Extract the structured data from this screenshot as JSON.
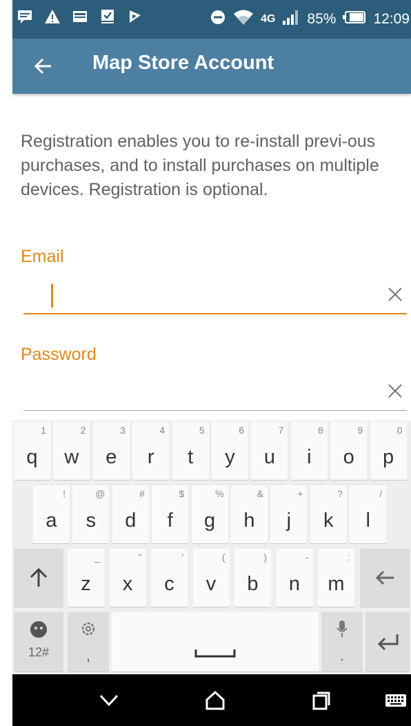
{
  "status_bar": {
    "battery": "85%",
    "time": "12:09",
    "network": "4G",
    "icons": [
      "message-icon",
      "warning-icon",
      "image-icon",
      "checkbox-icon",
      "flag-icon",
      "do-not-disturb-icon",
      "wifi-icon",
      "signal-icon",
      "battery-icon"
    ]
  },
  "appbar": {
    "title": "Map Store Account",
    "back_icon": "arrow-back-icon"
  },
  "content": {
    "description": "Registration enables you to re-install previ-ous purchases, and to install purchases on multiple devices. Registration is optional.",
    "email_label": "Email",
    "email_value": "",
    "password_label": "Password",
    "password_value": "",
    "clear_icon": "close-icon"
  },
  "keyboard": {
    "row1": [
      {
        "main": "q",
        "alt": "1"
      },
      {
        "main": "w",
        "alt": "2"
      },
      {
        "main": "e",
        "alt": "3"
      },
      {
        "main": "r",
        "alt": "4"
      },
      {
        "main": "t",
        "alt": "5"
      },
      {
        "main": "y",
        "alt": "6"
      },
      {
        "main": "u",
        "alt": "7"
      },
      {
        "main": "i",
        "alt": "8"
      },
      {
        "main": "o",
        "alt": "9"
      },
      {
        "main": "p",
        "alt": "0"
      }
    ],
    "row2": [
      {
        "main": "a",
        "alt": "!"
      },
      {
        "main": "s",
        "alt": "@"
      },
      {
        "main": "d",
        "alt": "#"
      },
      {
        "main": "f",
        "alt": "$"
      },
      {
        "main": "g",
        "alt": "%"
      },
      {
        "main": "h",
        "alt": "&"
      },
      {
        "main": "j",
        "alt": "+"
      },
      {
        "main": "k",
        "alt": "?"
      },
      {
        "main": "l",
        "alt": "/"
      }
    ],
    "row3": [
      {
        "main": "z",
        "alt": "_"
      },
      {
        "main": "x",
        "alt": "\""
      },
      {
        "main": "c",
        "alt": "'"
      },
      {
        "main": "v",
        "alt": "("
      },
      {
        "main": "b",
        "alt": ")"
      },
      {
        "main": "n",
        "alt": "-"
      },
      {
        "main": "m",
        "alt": ":"
      }
    ],
    "symbols_label": "12#",
    "comma_label": ",",
    "period_label": "."
  },
  "navbar": {
    "icons": [
      "back-chevron-icon",
      "home-icon",
      "recents-icon",
      "keyboard-icon"
    ]
  },
  "colors": {
    "accent": "#e0891a",
    "appbar": "#4c7fa1",
    "statusbar": "#2c5d7a"
  }
}
